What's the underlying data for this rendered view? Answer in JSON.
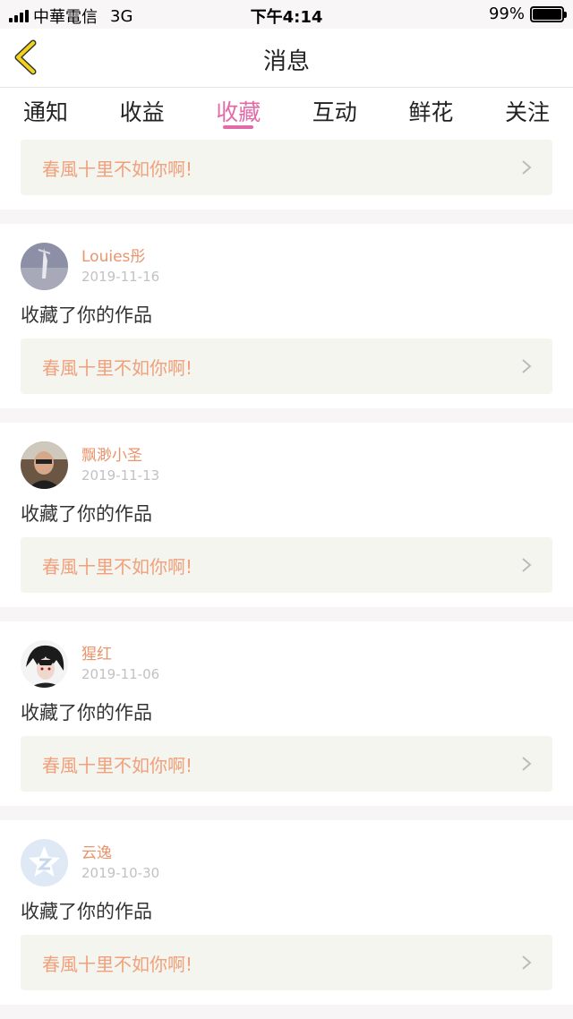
{
  "status": {
    "carrier": "中華電信",
    "network": "3G",
    "time": "下午4:14",
    "battery": "99%",
    "battery_level": 0.99
  },
  "header": {
    "title": "消息"
  },
  "tabs": [
    {
      "label": "通知"
    },
    {
      "label": "收益"
    },
    {
      "label": "收藏",
      "active": true
    },
    {
      "label": "互动"
    },
    {
      "label": "鲜花"
    },
    {
      "label": "关注"
    }
  ],
  "first_item": {
    "work_title": "春風十里不如你啊!"
  },
  "items": [
    {
      "user": "Louies彤",
      "date": "2019-11-16",
      "action": "收藏了你的作品",
      "work_title": "春風十里不如你啊!"
    },
    {
      "user": "飘渺小圣",
      "date": "2019-11-13",
      "action": "收藏了你的作品",
      "work_title": "春風十里不如你啊!"
    },
    {
      "user": "猩红",
      "date": "2019-11-06",
      "action": "收藏了你的作品",
      "work_title": "春風十里不如你啊!"
    },
    {
      "user": "云逸",
      "date": "2019-10-30",
      "action": "收藏了你的作品",
      "work_title": "春風十里不如你啊!"
    }
  ],
  "colors": {
    "accent": "#e36aa8",
    "username": "#e8946c",
    "work_title": "#f0a07c",
    "back_arrow": "#f2d21b"
  },
  "icons": {
    "back": "back-arrow-icon",
    "chevron": "chevron-right-icon"
  }
}
